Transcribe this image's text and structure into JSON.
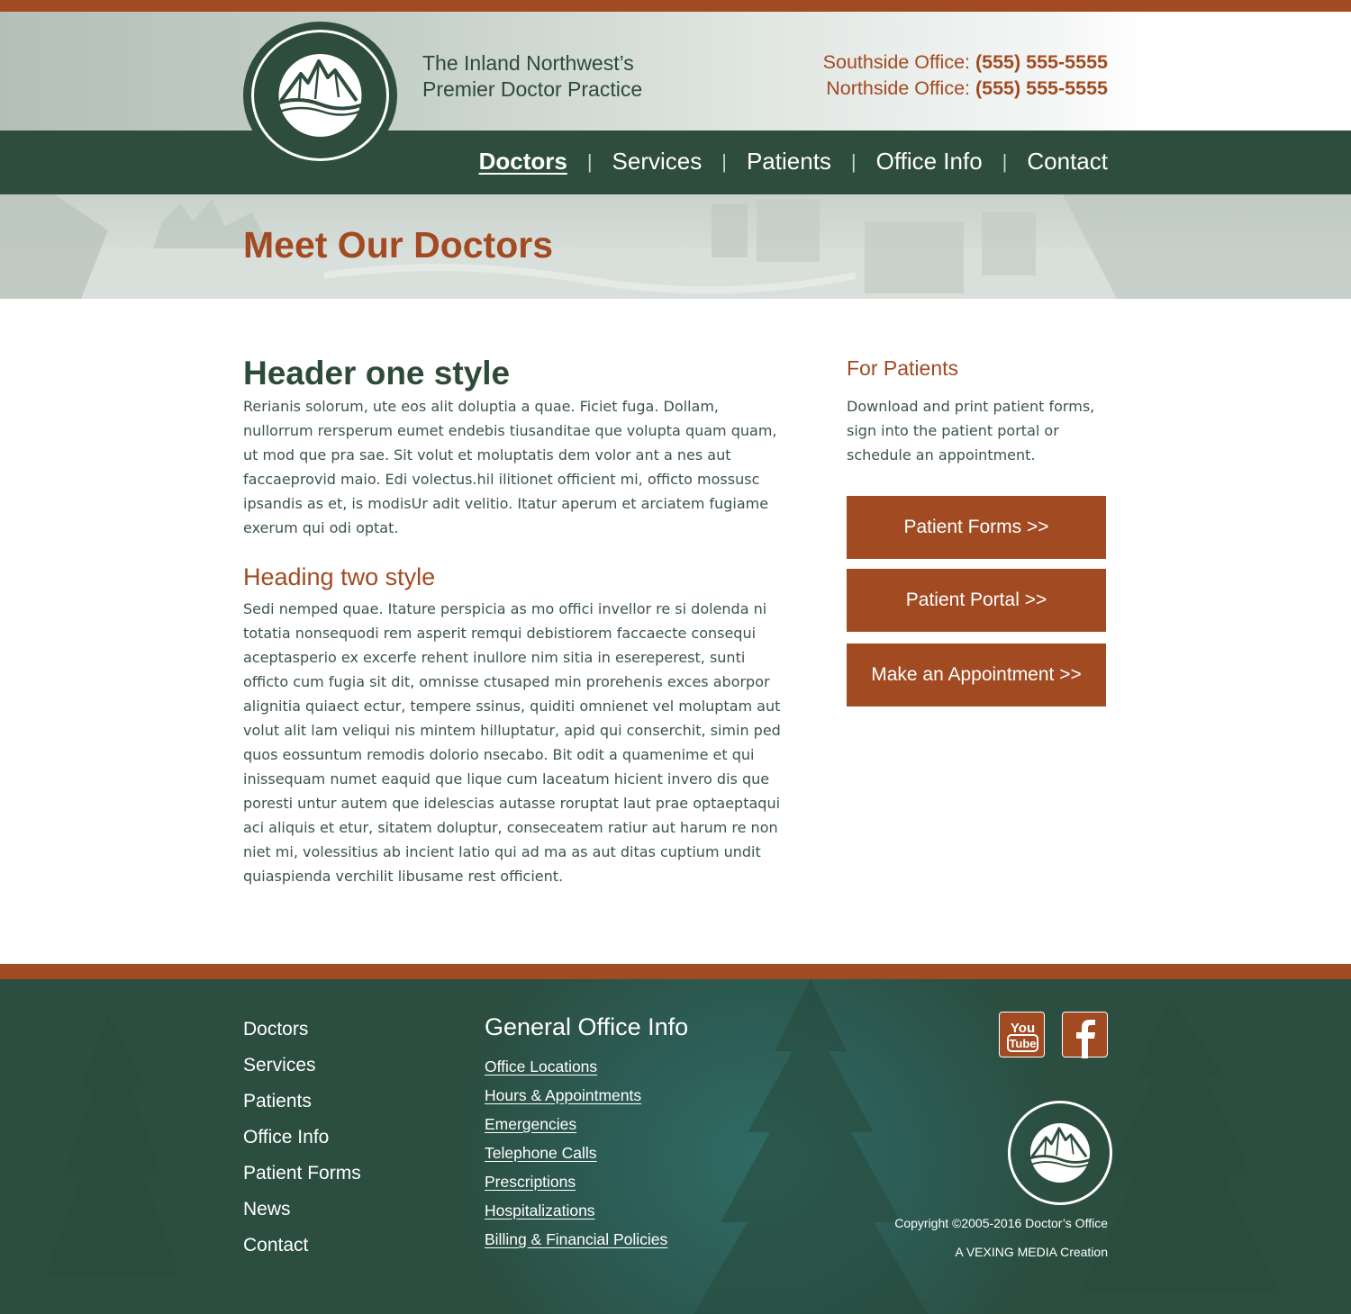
{
  "colors": {
    "rust": "#a24a22",
    "forest": "#2e4d3c",
    "text": "#3c5548"
  },
  "header": {
    "tagline_line1": "The Inland Northwest’s",
    "tagline_line2": "Premier Doctor Practice",
    "phones": [
      {
        "label": "Southside Office: ",
        "number": "(555) 555-5555"
      },
      {
        "label": "Northside Office: ",
        "number": "(555) 555-5555"
      }
    ],
    "logo_icon": "mountain-logo-icon"
  },
  "nav": {
    "items": [
      "Doctors",
      "Services",
      "Patients",
      "Office Info",
      "Contact"
    ],
    "active": "Doctors",
    "separator": "|"
  },
  "banner": {
    "title": "Meet Our Doctors"
  },
  "main": {
    "heading_one": "Header one style",
    "paragraph_one": "Rerianis solorum, ute eos alit doluptia a quae. Ficiet fuga. Dollam, nullorrum rersperum eumet endebis tiusanditae que volupta quam quam, ut mod que pra sae. Sit volut et moluptatis dem volor ant a nes aut faccaeprovid maio. Edi volectus.hil ilitionet officient mi, officto mossusc ipsandis as et, is modisUr adit velitio. Itatur aperum et arciatem fugiame exerum qui odi optat.",
    "heading_two": "Heading two style",
    "paragraph_two": "Sedi nemped quae. Itature perspicia as mo offici invellor re si dolenda ni totatia nonsequodi rem asperit remqui debistiorem faccaecte consequi aceptasperio ex excerfe rehent inullore nim sitia in esereperest, sunti officto cum fugia sit dit, omnisse ctusaped min prorehenis exces aborpor alignitia quiaect ectur, tempere ssinus, quiditi omnienet vel moluptam aut volut alit lam veliqui nis mintem hilluptatur, apid qui conserchit, simin ped quos eossuntum remodis dolorio nsecabo. Bit odit a quamenime et qui inissequam numet eaquid que lique cum laceatum hicient invero dis que poresti untur autem que idelescias autasse roruptat laut prae optaeptaqui aci aliquis et etur, sitatem doluptur, conseceatem ratiur aut harum re non niet mi, volessitius ab incient latio qui ad ma as aut ditas cuptium undit quiaspienda verchilit libusame rest officient."
  },
  "sidebar": {
    "title": "For Patients",
    "text": "Download and print patient forms, sign into the patient portal or schedule an appointment.",
    "buttons": [
      "Patient Forms >>",
      "Patient Portal >>",
      "Make an Appointment >>"
    ]
  },
  "footer": {
    "nav": [
      "Doctors",
      "Services",
      "Patients",
      "Office Info",
      "Patient Forms",
      "News",
      "Contact"
    ],
    "info_title": "General Office Info",
    "info_links": [
      "Office Locations",
      "Hours & Appointments",
      "Emergencies",
      "Telephone Calls",
      "Prescriptions",
      "Hospitalizations",
      "Billing & Financial Policies"
    ],
    "social": [
      {
        "name": "youtube-icon",
        "text_top": "You",
        "text_bottom": "Tube"
      },
      {
        "name": "facebook-icon",
        "glyph": "f"
      }
    ],
    "copyright": "Copyright ©2005-2016 Doctor’s Office",
    "credit": "A VEXING MEDIA Creation"
  }
}
